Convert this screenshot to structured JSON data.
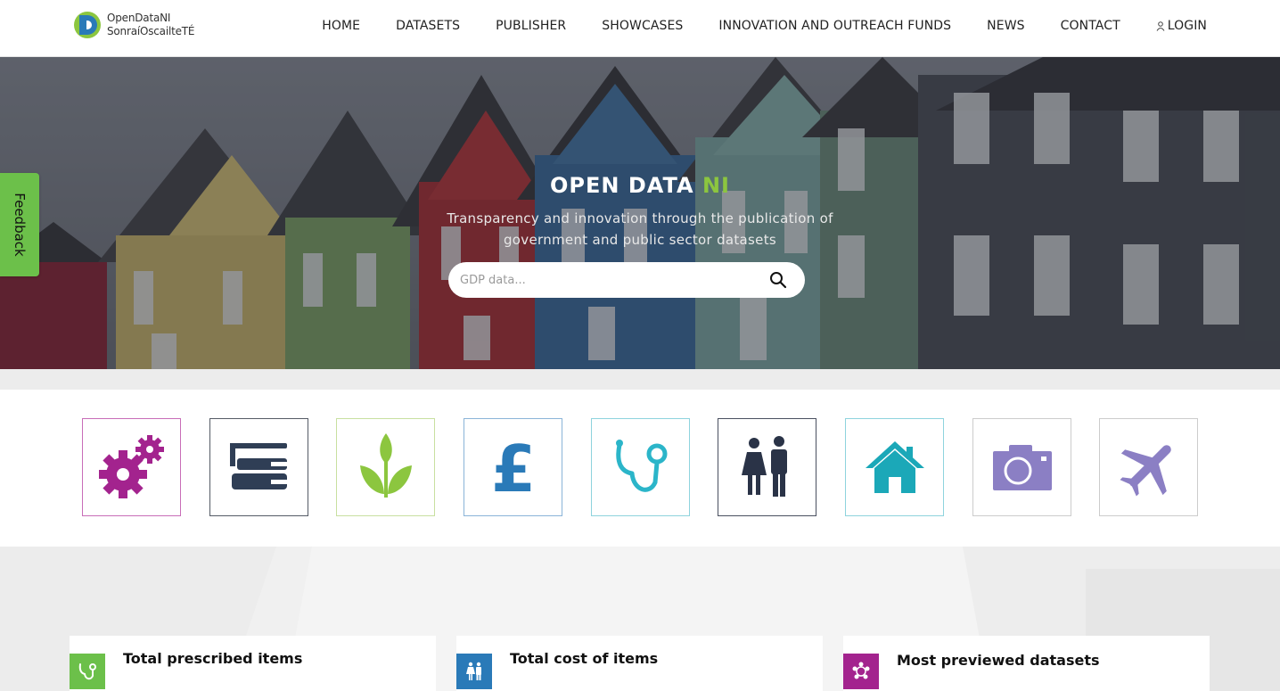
{
  "header": {
    "logo": {
      "line1": "OpenDataNI",
      "line2": "SonraíOscailteTÉ"
    },
    "nav": [
      {
        "label": "HOME"
      },
      {
        "label": "DATASETS"
      },
      {
        "label": "PUBLISHER"
      },
      {
        "label": "SHOWCASES"
      },
      {
        "label": "INNOVATION AND OUTREACH FUNDS"
      },
      {
        "label": "NEWS"
      },
      {
        "label": "CONTACT"
      }
    ],
    "login_label": "LOGIN"
  },
  "hero": {
    "title_main": "OPEN DATA ",
    "title_accent": "NI",
    "subtitle": "Transparency and innovation through the publication of government and public sector datasets",
    "search_placeholder": "GDP data...",
    "search_value": ""
  },
  "feedback_label": "Feedback",
  "categories": [
    {
      "icon": "gears-icon",
      "color": "#a3238e"
    },
    {
      "icon": "books-icon",
      "color": "#2f3e55"
    },
    {
      "icon": "plant-icon",
      "color": "#8cc63f"
    },
    {
      "icon": "pound-icon",
      "color": "#2a7ab8"
    },
    {
      "icon": "stethoscope-icon",
      "color": "#2bb5c9"
    },
    {
      "icon": "people-icon",
      "color": "#2a3347"
    },
    {
      "icon": "house-icon",
      "color": "#1ba8b8"
    },
    {
      "icon": "camera-icon",
      "color": "#8b7fc4"
    },
    {
      "icon": "airplane-icon",
      "color": "#8b7fc4"
    }
  ],
  "stats": [
    {
      "title": "Total prescribed items",
      "icon": "stethoscope-icon",
      "color": "#6cc04a"
    },
    {
      "title": "Total cost of items",
      "icon": "people-icon",
      "color": "#2a7ab8"
    },
    {
      "title": "Most previewed datasets",
      "icon": "network-icon",
      "color": "#a3238e"
    }
  ]
}
